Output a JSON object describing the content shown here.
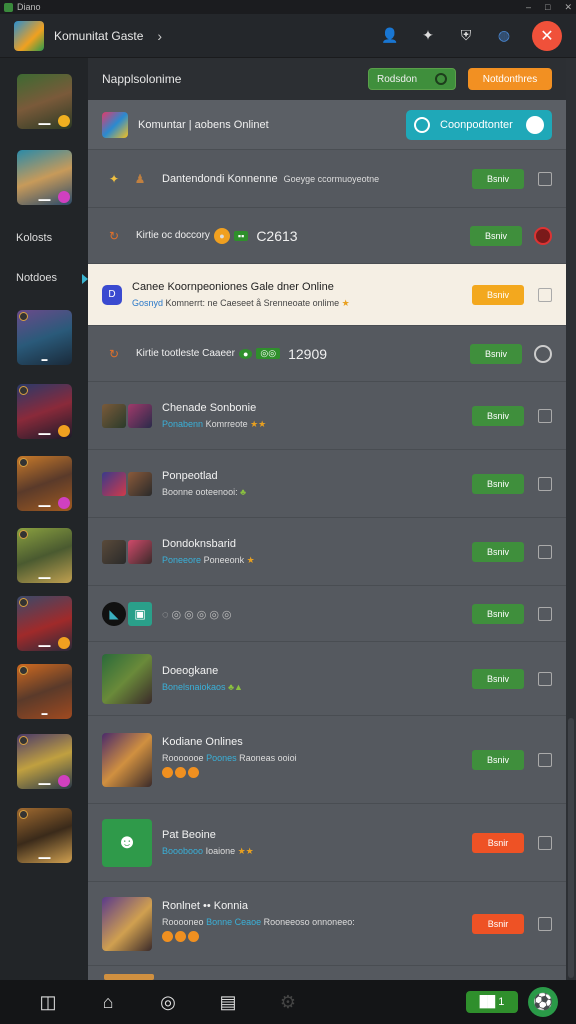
{
  "window": {
    "title": "Diano"
  },
  "header": {
    "title": "Komunitat Gaste",
    "chevron": "›",
    "icons": [
      "user-icon",
      "puzzle-icon",
      "shield-icon",
      "globe-icon",
      "close-icon"
    ]
  },
  "sidebar": {
    "nav": [
      {
        "label": "Kolosts"
      },
      {
        "label": "Notdoes"
      }
    ]
  },
  "section": {
    "title": "Napplsolonime",
    "green_button": "Rodsdon",
    "orange_button": "Notdonthres"
  },
  "filter": {
    "label": "Komuntar | aobens Onlinet",
    "toggle_label": "Coonpodtonter"
  },
  "rows": [
    {
      "title": "Dantendondi Konnenne",
      "sub": "Goeyge ccormuoyeotne",
      "action": "Bsniv"
    },
    {
      "title": "Kirtie oc doccory",
      "big": "C2613",
      "action": "Bsniv"
    },
    {
      "title": "Canee Koornpeoniones Gale dner Online",
      "sub_accent": "Gosnyd",
      "sub": "Komnerrt: ne Caeseet å Srenneoate onlime",
      "action": "Bsniv"
    },
    {
      "title": "Kirtie tootleste Caaeer",
      "big": "12909",
      "action": "Bsniv"
    },
    {
      "title": "Chenade Sonbonie",
      "sub_accent": "Ponabenn",
      "sub": "Komrreote",
      "action": "Bsniv"
    },
    {
      "title": "Ponpeotlad",
      "sub": "Boonne ooteenooi:",
      "action": "Bsniv"
    },
    {
      "title": "Dondoknsbarid",
      "sub_accent": "Poneeore",
      "sub": "Poneeonk",
      "action": "Bsniv"
    },
    {
      "title": "",
      "action": "Bsniv"
    },
    {
      "title": "Doeogkane",
      "sub_accent": "Bonelsnaiokaos",
      "sub": "",
      "action": "Bsniv"
    },
    {
      "title": "Kodiane Onlines",
      "sub_accent": "Poones",
      "sub": "Raoneas ooioi",
      "action": "Bsniv"
    },
    {
      "title": "Pat Beoine",
      "sub_accent": "Booobooo",
      "sub": "Ioaione",
      "action": "Bsnir"
    },
    {
      "title": "Ronlnet •• Konnia",
      "sub_accent": "Bonne Ceaoe",
      "sub": "Rooneeoso onnoneeo:",
      "action": "Bsnir"
    }
  ],
  "bottom": {
    "pill": "██ 1",
    "nav_icons": [
      "dashboard-icon",
      "home-icon",
      "compass-icon",
      "list-icon",
      "settings-icon"
    ]
  },
  "colors": {
    "green": "#3f8f3c",
    "orange": "#f3a81e",
    "red": "#ee5225",
    "teal": "#1fa8b8"
  }
}
